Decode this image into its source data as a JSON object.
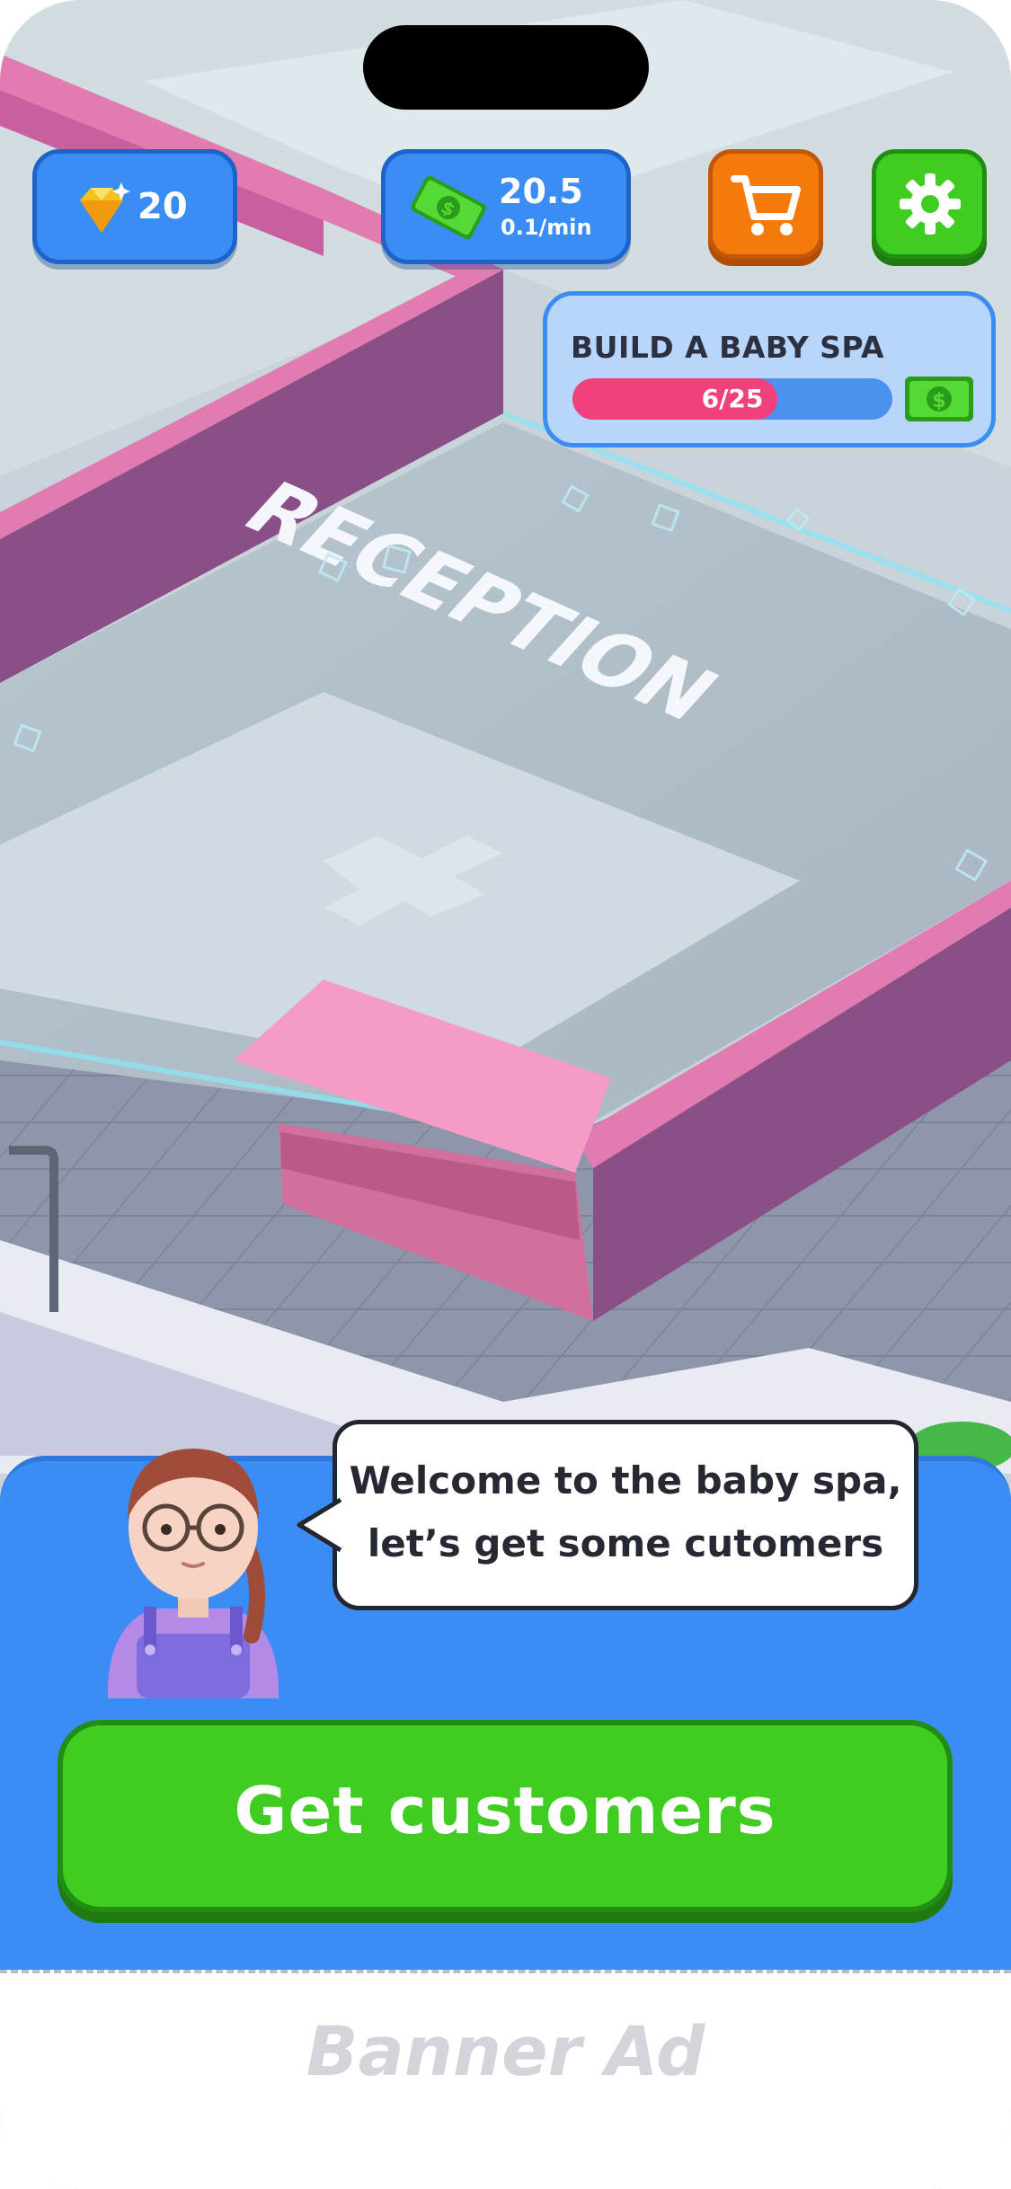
{
  "hud": {
    "gems": "20",
    "cash_amount": "20.5",
    "cash_rate": "0.1/min"
  },
  "quest": {
    "title": "BUILD A BABY SPA",
    "progress_text": "6/25",
    "progress_fraction": 0.24
  },
  "scene": {
    "floor_label": "RECEPTION"
  },
  "dialog": {
    "line1": "Welcome to the baby spa,",
    "line2": "let’s get some cutomers"
  },
  "cta": {
    "label": "Get customers"
  },
  "ad": {
    "label": "Banner Ad"
  },
  "colors": {
    "hud_blue": "#3a8df4",
    "shop_orange": "#f57a0c",
    "settings_green": "#3fcd22",
    "progress_pink": "#f1417c",
    "wall_pink": "#e27bb0"
  },
  "icons": {
    "gem": "gem-icon",
    "cash": "cash-icon",
    "shop": "cart-icon",
    "settings": "gear-icon",
    "reward": "cash-reward-icon"
  }
}
